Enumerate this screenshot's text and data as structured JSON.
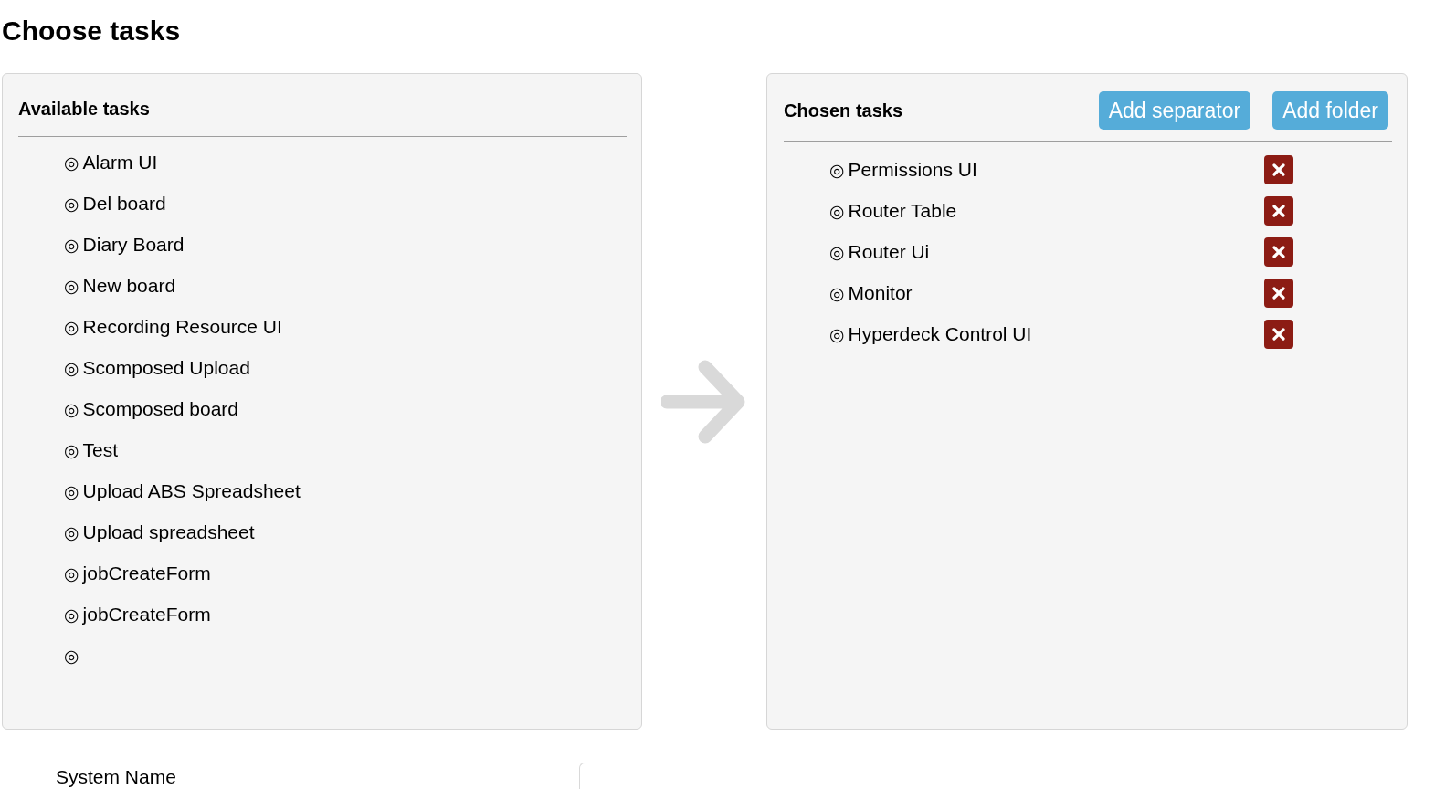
{
  "page_title": "Choose tasks",
  "available": {
    "title": "Available tasks",
    "items": [
      {
        "icon": "◎",
        "label": "Alarm UI"
      },
      {
        "icon": "◎",
        "label": "Del board"
      },
      {
        "icon": "◎",
        "label": "Diary Board"
      },
      {
        "icon": "◎",
        "label": "New board"
      },
      {
        "icon": "◎",
        "label": "Recording Resource UI"
      },
      {
        "icon": "◎",
        "label": "Scomposed Upload"
      },
      {
        "icon": "◎",
        "label": "Scomposed board"
      },
      {
        "icon": "◎",
        "label": "Test"
      },
      {
        "icon": "◎",
        "label": "Upload ABS Spreadsheet"
      },
      {
        "icon": "◎",
        "label": "Upload spreadsheet"
      },
      {
        "icon": "◎",
        "label": "jobCreateForm"
      },
      {
        "icon": "◎",
        "label": "jobCreateForm"
      },
      {
        "icon": "◎"
      }
    ]
  },
  "chosen": {
    "title": "Chosen tasks",
    "buttons": [
      "Add separator",
      "Add folder"
    ],
    "items": [
      {
        "icon": "◎",
        "label": "Permissions UI"
      },
      {
        "icon": "◎",
        "label": "Router Table"
      },
      {
        "icon": "◎",
        "label": "Router Ui"
      },
      {
        "icon": "◎",
        "label": "Monitor"
      },
      {
        "icon": "◎",
        "label": "Hyperdeck Control UI"
      }
    ]
  },
  "system_name": {
    "label": "System Name"
  }
}
